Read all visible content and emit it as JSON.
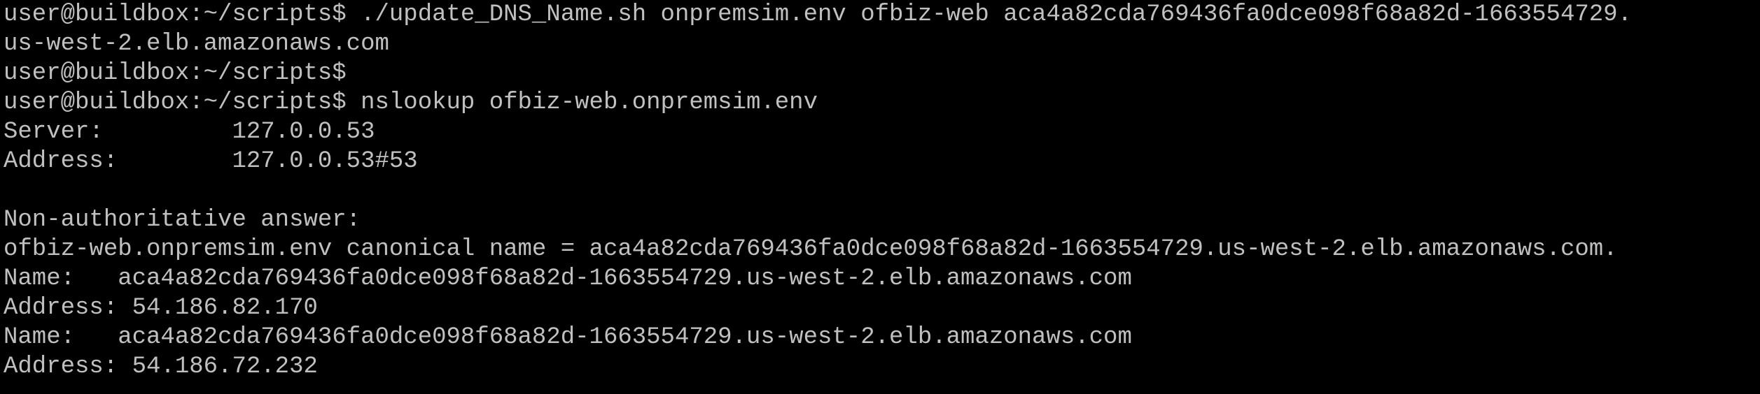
{
  "terminal": {
    "colors": {
      "background": "#000000",
      "foreground": "#c0c0c0"
    },
    "lines": [
      "user@buildbox:~/scripts$ ./update_DNS_Name.sh onpremsim.env ofbiz-web aca4a82cda769436fa0dce098f68a82d-1663554729.",
      "us-west-2.elb.amazonaws.com",
      "user@buildbox:~/scripts$",
      "user@buildbox:~/scripts$ nslookup ofbiz-web.onpremsim.env",
      "Server:         127.0.0.53",
      "Address:        127.0.0.53#53",
      "",
      "Non-authoritative answer:",
      "ofbiz-web.onpremsim.env canonical name = aca4a82cda769436fa0dce098f68a82d-1663554729.us-west-2.elb.amazonaws.com.",
      "Name:   aca4a82cda769436fa0dce098f68a82d-1663554729.us-west-2.elb.amazonaws.com",
      "Address: 54.186.82.170",
      "Name:   aca4a82cda769436fa0dce098f68a82d-1663554729.us-west-2.elb.amazonaws.com",
      "Address: 54.186.72.232"
    ]
  }
}
